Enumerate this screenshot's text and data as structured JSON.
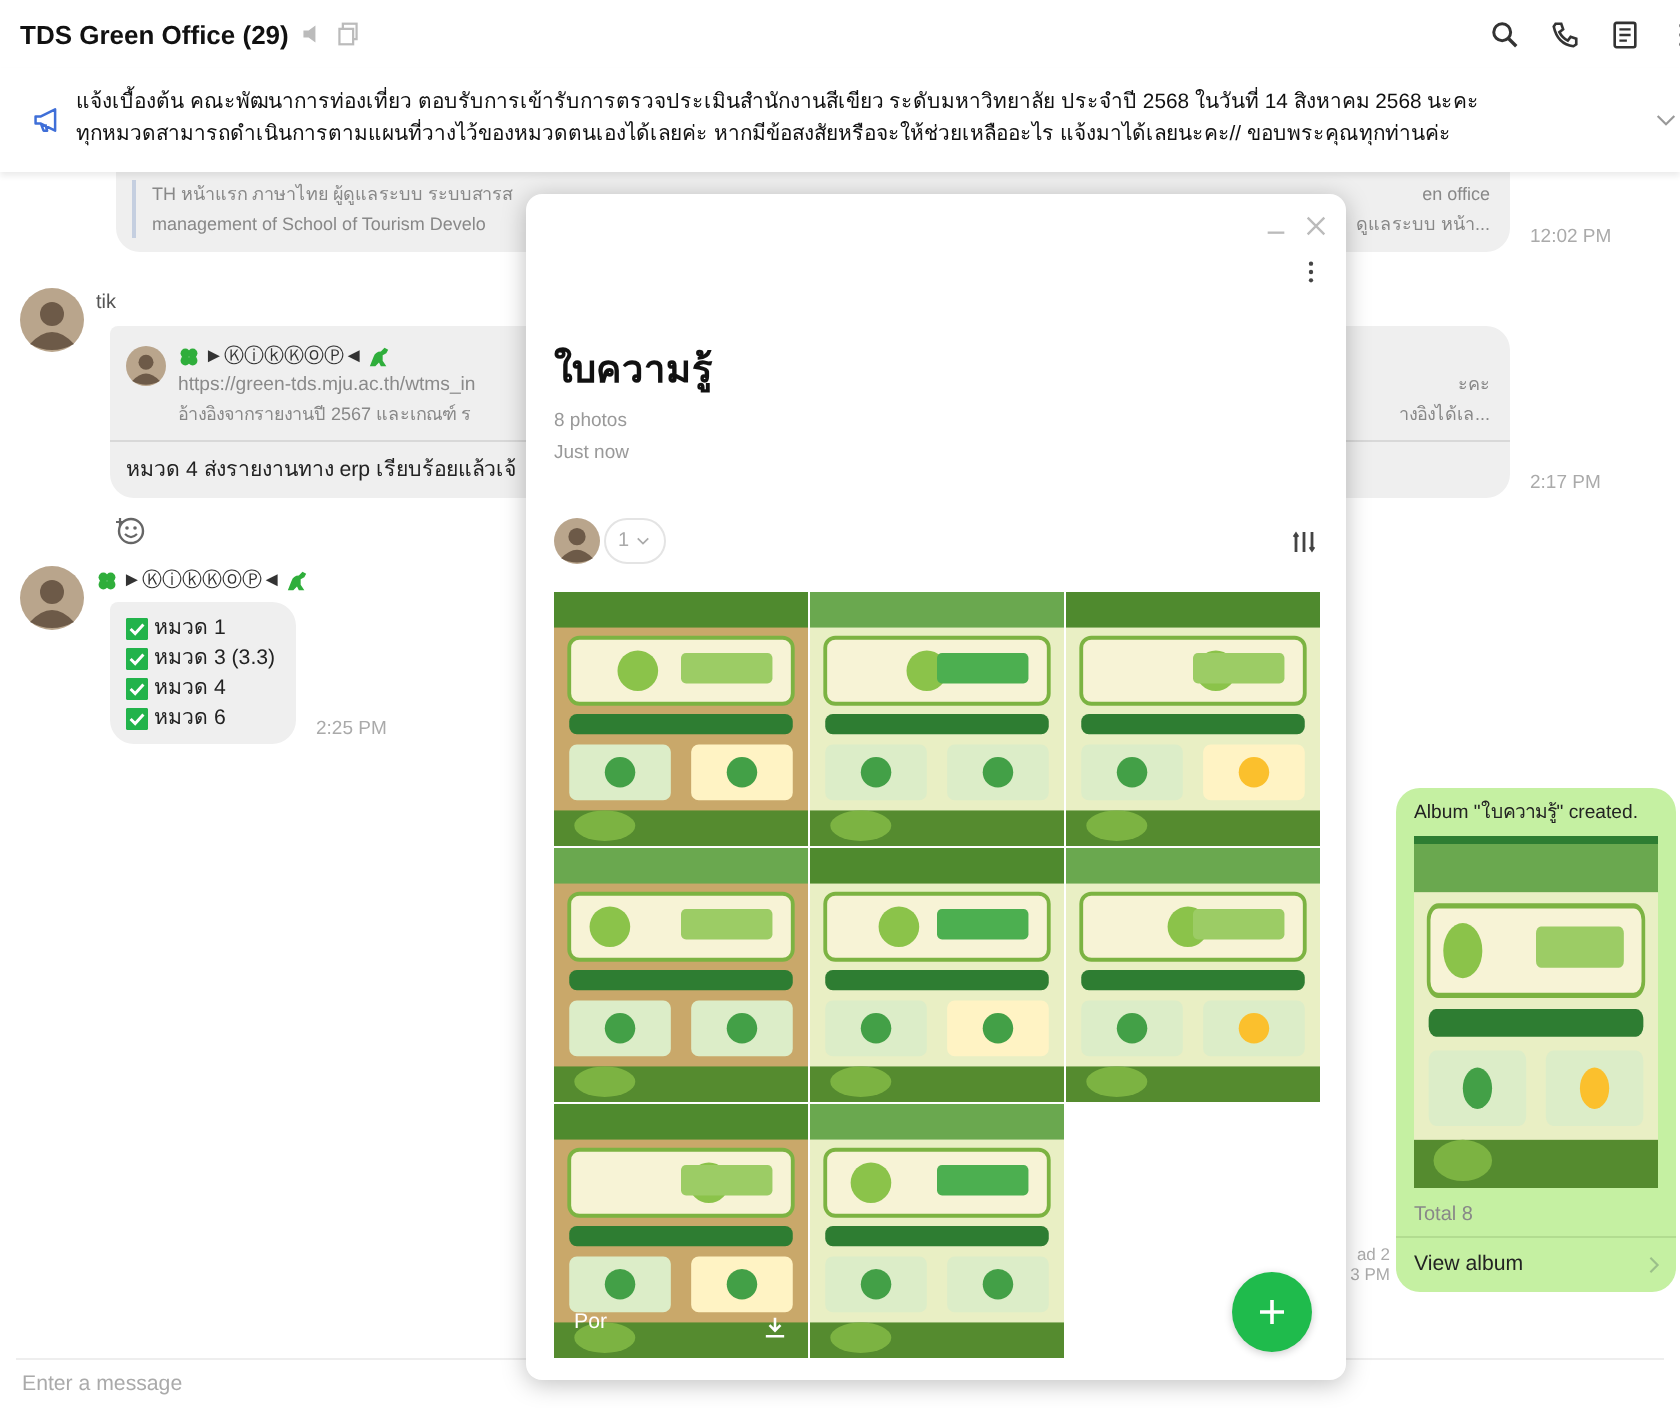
{
  "header": {
    "title": "TDS Green Office (29)"
  },
  "announcement": {
    "lines": [
      "แจ้งเบื้องต้น คณะพัฒนาการท่องเที่ยว ตอบรับการเข้ารับการตรวจประเมินสำนักงานสีเขียว ระดับมหาวิทยาลัย ประจำปี 2568 ในวันที่ 14 สิงหาคม 2568 นะคะ",
      "ทุกหมวดสามารถดำเนินการตามแผนที่วางไว้ของหมวดตนเองได้เลยค่ะ หากมีข้อสงสัยหรือจะให้ช่วยเหลืออะไร แจ้งมาได้เลยนะคะ// ขอบพระคุณทุกท่านค่ะ"
    ]
  },
  "messages": [
    {
      "kind": "preview",
      "lines": [
        {
          "left": "TH หน้าแรก ภาษาไทย ผู้ดูแลระบบ ระบบสารส",
          "right": "en office"
        },
        {
          "left": "management of School of Tourism Develo",
          "right": "ดูแลระบบ หน้า..."
        }
      ],
      "time": "12:02 PM"
    },
    {
      "kind": "link",
      "sender": "tik",
      "preview": {
        "name": "►ⓀⓘⓚⓀⓞⓅ◄",
        "lines": [
          {
            "left": "https://green-tds.mju.ac.th/wtms_in",
            "right": "ะคะ"
          },
          {
            "left": "อ้างอิงจากรายงานปี 2567 และเกณฑ์ ร",
            "right": "างอิงได้เล..."
          }
        ]
      },
      "text": "หมวด 4 ส่งรายงานทาง erp เรียบร้อยแล้วเจ้",
      "time": "2:17 PM",
      "reaction": true
    },
    {
      "kind": "checklist",
      "sender": "►ⓀⓘⓚⓀⓞⓅ◄",
      "items": [
        {
          "label": "หมวด 1",
          "checked": true
        },
        {
          "label": "หมวด 3 (3.3)",
          "checked": true
        },
        {
          "label": "หมวด 4",
          "checked": true
        },
        {
          "label": "หมวด 6",
          "checked": true
        }
      ],
      "time": "2:25 PM"
    },
    {
      "kind": "album",
      "title": "Album \"ใบความรู้\" created.",
      "total": "Total 8",
      "action": "View album",
      "read": "ad 2",
      "time": "3 PM"
    }
  ],
  "album_viewer": {
    "title": "ใบความรู้",
    "count": "8 photos",
    "time": "Just now",
    "members": "1",
    "photos": [
      {
        "kind": "picture"
      },
      {
        "kind": "picture"
      },
      {
        "kind": "picture"
      },
      {
        "kind": "picture"
      },
      {
        "kind": "picture"
      },
      {
        "kind": "picture"
      },
      {
        "kind": "picture",
        "uploader": "Por"
      },
      {
        "kind": "picture"
      }
    ]
  },
  "input": {
    "placeholder": "Enter a message"
  }
}
